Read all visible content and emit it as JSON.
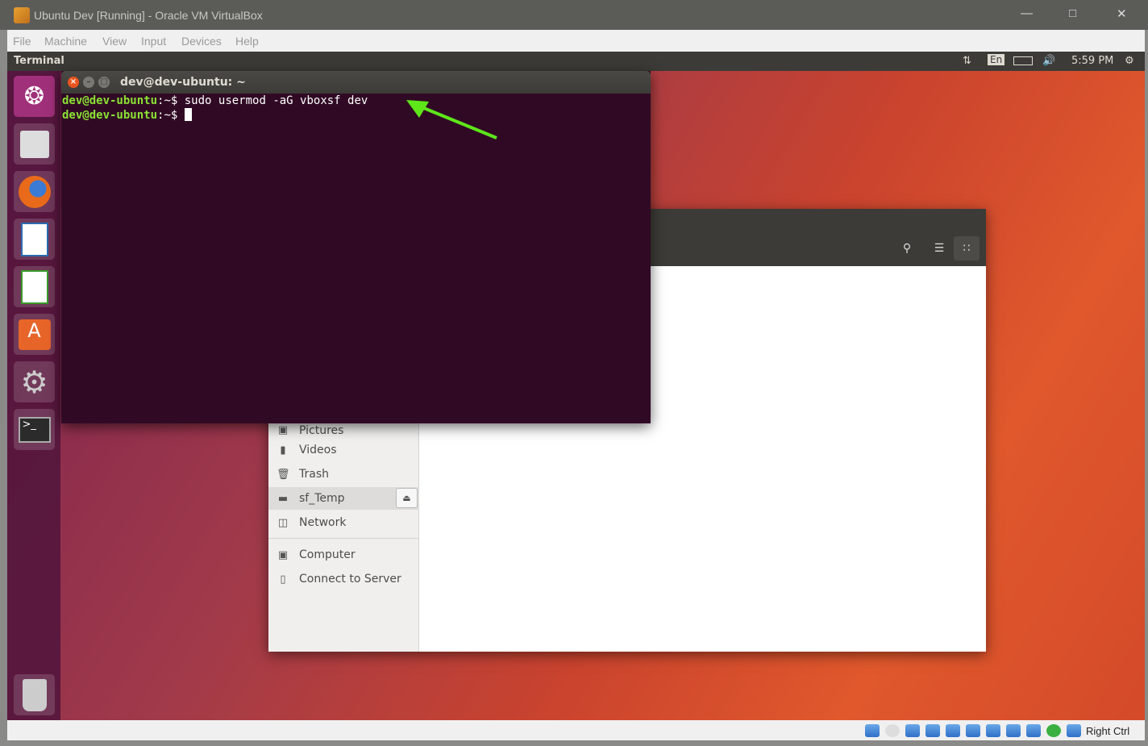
{
  "host": {
    "title": "Ubuntu Dev [Running] - Oracle VM VirtualBox",
    "menu": [
      "File",
      "Machine",
      "View",
      "Input",
      "Devices",
      "Help"
    ],
    "status_key": "Right Ctrl"
  },
  "panel": {
    "app_title": "Terminal",
    "keyboard": "En",
    "time": "5:59 PM"
  },
  "terminal": {
    "title": "dev@dev-ubuntu: ~",
    "prompt": "dev@dev-ubuntu",
    "path": ":~$",
    "command": " sudo usermod -aG vboxsf dev"
  },
  "files": {
    "sidebar": [
      "Pictures",
      "Videos",
      "Trash",
      "sf_Temp",
      "Network",
      "Computer",
      "Connect to Server"
    ]
  },
  "colors": {
    "terminal_bg": "#300a24",
    "prompt": "#8ae234",
    "arrow": "#5ee61a"
  }
}
